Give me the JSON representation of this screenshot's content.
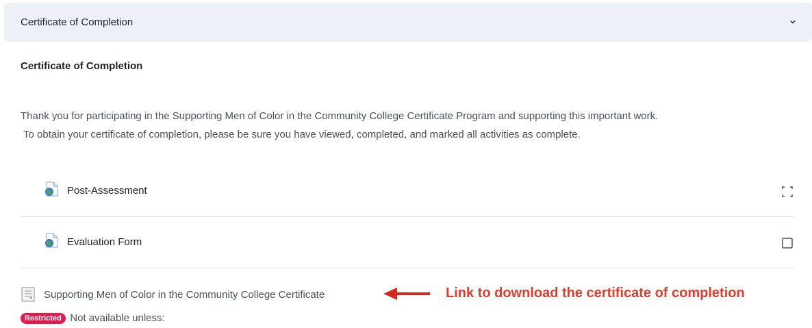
{
  "section": {
    "header_title": "Certificate of Completion",
    "summary_title": "Certificate of Completion",
    "summary_line1": "Thank you for participating in the Supporting Men of Color in the Community College Certificate Program and supporting this important work.",
    "summary_line2": "To obtain your certificate of completion, please be sure you have viewed, completed, and marked all activities as complete."
  },
  "activities": [
    {
      "name": "Post-Assessment",
      "icon": "url-globe-icon",
      "completion": "auto-completion-icon"
    },
    {
      "name": "Evaluation Form",
      "icon": "url-globe-icon",
      "completion": "manual-completion-checkbox"
    }
  ],
  "certificate": {
    "name": "Supporting Men of Color in the Community College Certificate",
    "icon": "document-icon",
    "restricted_badge": "Restricted",
    "restriction_text": "Not available unless:"
  },
  "annotation": {
    "text": "Link to download the certificate of completion",
    "color": "#e23c2c"
  },
  "colors": {
    "header_bg": "#eef0f8",
    "badge_bg": "#e3194f",
    "text_muted": "#495057"
  }
}
